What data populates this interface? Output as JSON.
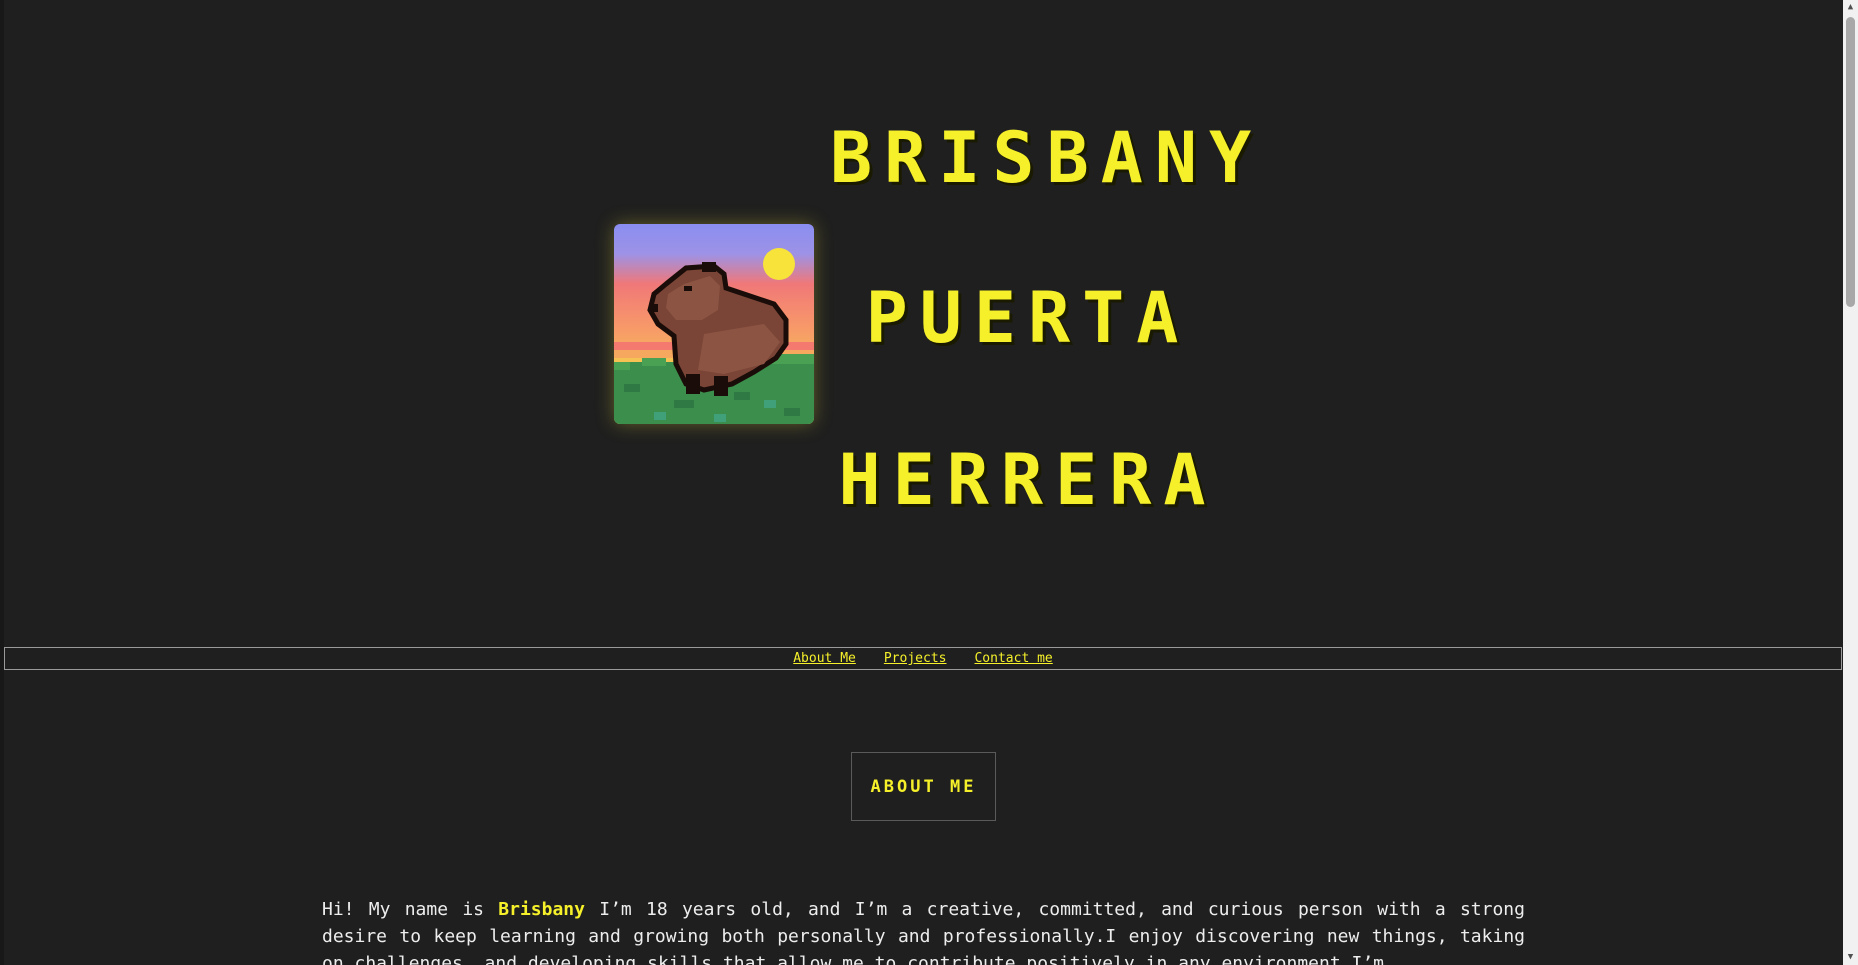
{
  "hero": {
    "name_lines": [
      "BRISBANY",
      "PUERTA",
      "HERRERA"
    ],
    "avatar_icon": "capybara-pixel-art-icon"
  },
  "nav": {
    "links": [
      "About Me",
      "Projects",
      "Contact me"
    ]
  },
  "about": {
    "heading": "ABOUT ME",
    "intro": "Hi! My name is ",
    "highlight": "Brisbany",
    "body": " I’m 18 years old, and I’m a creative, committed, and curious person with a strong desire to keep learning and growing both personally and professionally.I enjoy discovering new things, taking on challenges, and developing skills that allow me to contribute positively in any environment.I’m"
  },
  "colors": {
    "background": "#1f1f1f",
    "accent_yellow": "#f5f02a",
    "text": "#ededed",
    "nav_border": "#9a9a9a"
  }
}
